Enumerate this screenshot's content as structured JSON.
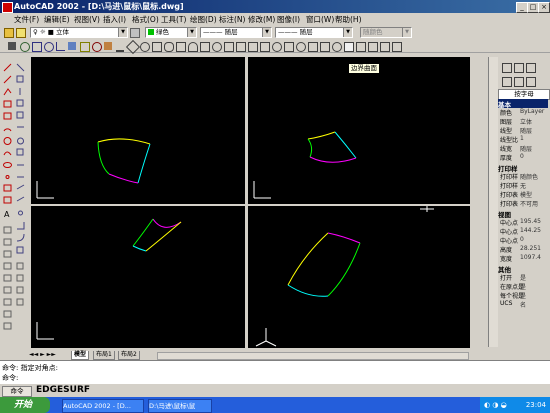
{
  "window": {
    "title": "AutoCAD 2002 - [D:\\马进\\鼠标\\鼠标.dwg]"
  },
  "menu": [
    "文件(F)",
    "编辑(E)",
    "视图(V)",
    "插入(I)",
    "格式(O)",
    "工具(T)",
    "绘图(D)",
    "标注(N)",
    "修改(M)",
    "图像(I)",
    "窗口(W)",
    "帮助(H)"
  ],
  "layers": {
    "layer_value": "立体",
    "color_value": "绿色",
    "linetype_value": "随层",
    "lineweight_value": "随层",
    "plotstyle_value": "随颜色"
  },
  "tooltip": "边界曲面",
  "properties": {
    "tab": "按字母",
    "sections": [
      {
        "title": "基本",
        "rows": [
          {
            "k": "颜色",
            "v": "ByLayer"
          },
          {
            "k": "图层",
            "v": "立体"
          },
          {
            "k": "线型",
            "v": "随层"
          },
          {
            "k": "线型比",
            "v": "1"
          },
          {
            "k": "线宽",
            "v": "随层"
          },
          {
            "k": "厚度",
            "v": "0"
          }
        ]
      },
      {
        "title": "打印样",
        "rows": [
          {
            "k": "打印样",
            "v": "随颜色"
          },
          {
            "k": "打印样",
            "v": "无"
          },
          {
            "k": "打印表",
            "v": "模型"
          },
          {
            "k": "打印表",
            "v": "不可用"
          }
        ]
      },
      {
        "title": "视图",
        "rows": [
          {
            "k": "中心点",
            "v": "195.45"
          },
          {
            "k": "中心点",
            "v": "144.25"
          },
          {
            "k": "中心点",
            "v": "0"
          },
          {
            "k": "高度",
            "v": "28.251"
          },
          {
            "k": "宽度",
            "v": "1097.4"
          }
        ]
      },
      {
        "title": "其他",
        "rows": [
          {
            "k": "打开",
            "v": "是"
          },
          {
            "k": "在原点是",
            "v": "是"
          },
          {
            "k": "每个视是",
            "v": "是"
          },
          {
            "k": "UCS",
            "v": "名"
          }
        ]
      }
    ]
  },
  "tabs": [
    "模型",
    "布局1",
    "布局2"
  ],
  "command": {
    "line1": "命令: 指定对角点:",
    "line2": "命令:"
  },
  "status": {
    "command_prefix": "命令",
    "command_text": "EDGESURF"
  },
  "taskbar": {
    "start": "开始",
    "tasks": [
      "AutoCAD 2002 - [D...",
      "D:\\马进\\鼠标\\鼠"
    ],
    "clock": "23:04"
  },
  "colors": {
    "titlebar": "#0a246a",
    "viewport": "#000000",
    "curve_yellow": "#ffff00",
    "curve_green": "#00ff00",
    "curve_cyan": "#00ffff",
    "curve_magenta": "#ff00ff",
    "taskbar": "#245edb"
  }
}
